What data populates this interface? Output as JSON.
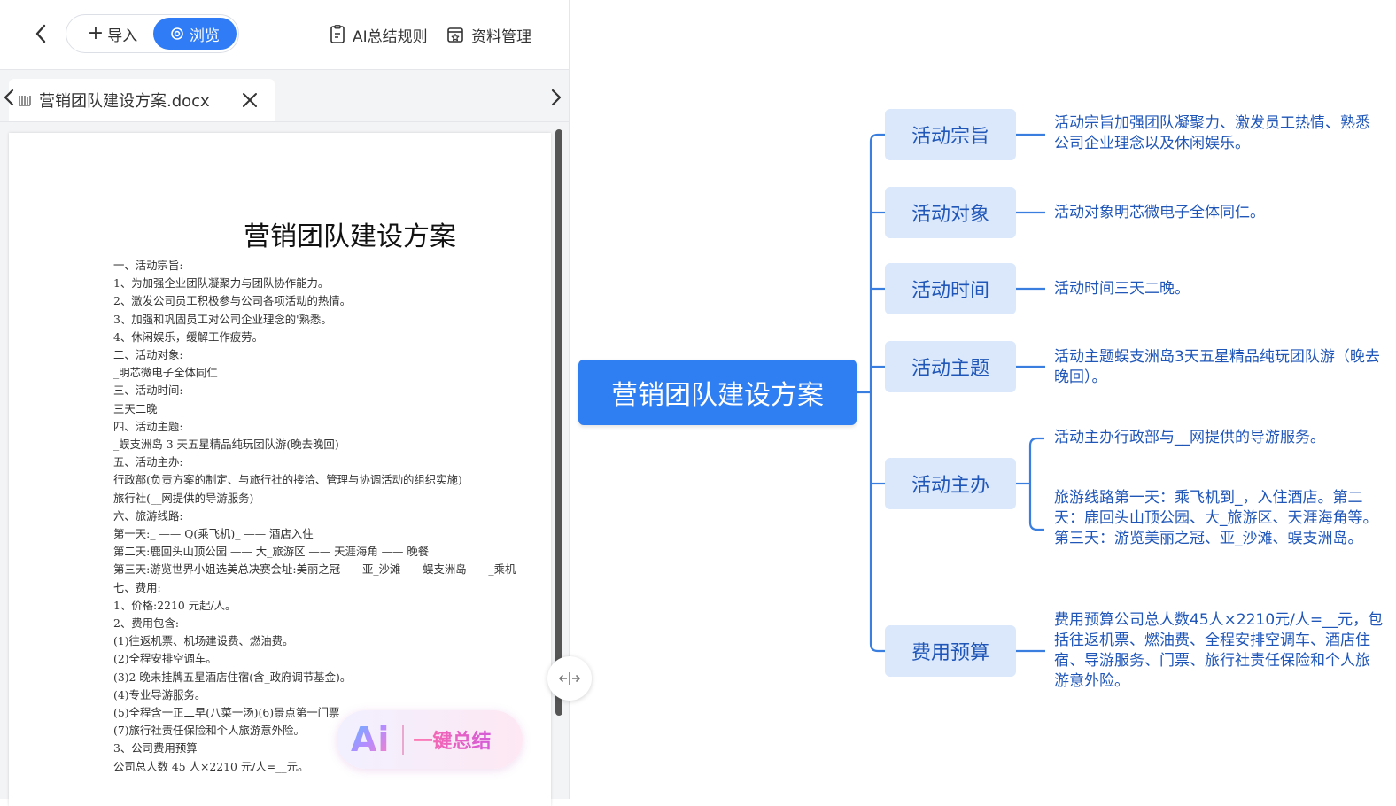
{
  "toolbar": {
    "import_label": "导入",
    "browse_label": "浏览",
    "ai_rules_label": "AI总结规则",
    "materials_label": "资料管理"
  },
  "tab": {
    "title": "营销团队建设方案.docx"
  },
  "document": {
    "title": "营销团队建设方案",
    "lines": [
      "一、活动宗旨:",
      "1、为加强企业团队凝聚力与团队协作能力。",
      "2、激发公司员工积极参与公司各项活动的热情。",
      "3、加强和巩固员工对公司企业理念的'熟悉。",
      "4、休闲娱乐，缓解工作疲劳。",
      "二、活动对象:",
      "_明芯微电子全体同仁",
      "三、活动时间:",
      "三天二晚",
      "四、活动主题:",
      "_蜈支洲岛 3 天五星精品纯玩团队游(晚去晚回)",
      "五、活动主办:",
      "行政部(负责方案的制定、与旅行社的接洽、管理与协调活动的组织实施)",
      "旅行社(__网提供的导游服务)",
      "六、旅游线路:",
      "第一天:_ —— Q(乘飞机)_ —— 酒店入住",
      "第二天:鹿回头山顶公园 —— 大_旅游区 —— 天涯海角 —— 晚餐",
      "第三天:游览世界小姐选美总决赛会址:美丽之冠——亚_沙滩——蜈支洲岛——_乘机",
      "七、费用:",
      "1、价格:2210 元起/人。",
      "2、费用包含:",
      "(1)往返机票、机场建设费、燃油费。",
      "(2)全程安排空调车。",
      "(3)2 晚未挂牌五星酒店住宿(含_政府调节基金)。",
      "(4)专业导游服务。",
      "(5)全程含一正二早(八菜一汤)(6)景点第一门票",
      "(7)旅行社责任保险和个人旅游意外险。",
      "3、公司费用预算",
      "公司总人数 45 人×2210 元/人=__元。"
    ]
  },
  "ai_button": {
    "logo": "Ai",
    "label": "一键总结"
  },
  "mindmap": {
    "root": "营销团队建设方案",
    "nodes": [
      {
        "label": "活动宗旨",
        "leaves": [
          "活动宗旨加强团队凝聚力、激发员工热情、熟悉公司企业理念以及休闲娱乐。"
        ]
      },
      {
        "label": "活动对象",
        "leaves": [
          "活动对象明芯微电子全体同仁。"
        ]
      },
      {
        "label": "活动时间",
        "leaves": [
          "活动时间三天二晚。"
        ]
      },
      {
        "label": "活动主题",
        "leaves": [
          "活动主题蜈支洲岛3天五星精品纯玩团队游（晚去晚回）。"
        ]
      },
      {
        "label": "活动主办",
        "leaves": [
          "活动主办行政部与__网提供的导游服务。",
          "旅游线路第一天：乘飞机到_，入住酒店。第二天：鹿回头山顶公园、大_旅游区、天涯海角等。第三天：游览美丽之冠、亚_沙滩、蜈支洲岛。"
        ]
      },
      {
        "label": "费用预算",
        "leaves": [
          "费用预算公司总人数45人×2210元/人=__元，包括往返机票、燃油费、全程安排空调车、酒店住宿、导游服务、门票、旅行社责任保险和个人旅游意外险。"
        ]
      }
    ],
    "colors": {
      "root": "#2f7ff2",
      "node_bg": "#dbe8fb",
      "text": "#1f56b8",
      "line": "#3a7fe0"
    }
  }
}
